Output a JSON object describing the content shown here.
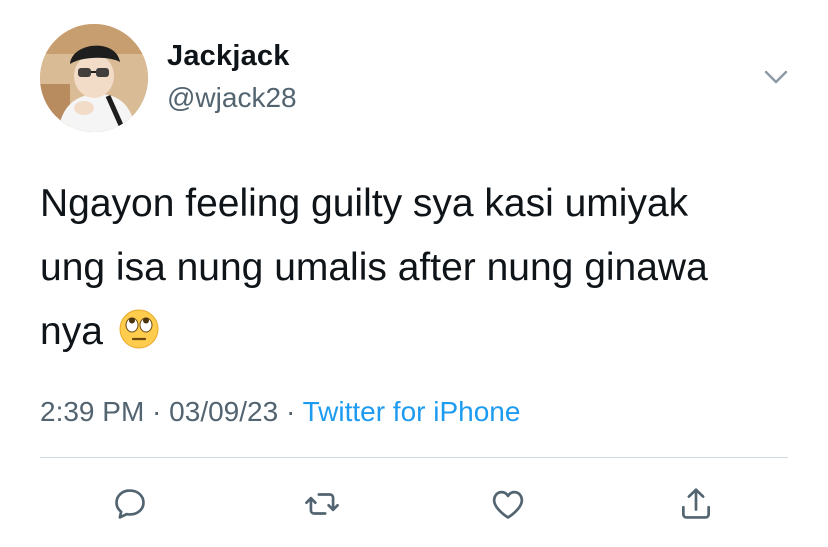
{
  "user": {
    "display_name": "Jackjack",
    "handle": "@wjack28",
    "avatar_icon": "profile-photo"
  },
  "tweet": {
    "text": "Ngayon feeling guilty sya kasi umiyak\nung isa nung umalis after nung ginawa\nnya",
    "emoji": "face-with-rolling-eyes",
    "time": "2:39 PM",
    "separator": " · ",
    "date": "03/09/23",
    "source": "Twitter for iPhone"
  },
  "actions": {
    "reply_icon": "reply-icon",
    "retweet_icon": "retweet-icon",
    "like_icon": "like-icon",
    "share_icon": "share-icon"
  },
  "colors": {
    "text": "#0f1419",
    "secondary": "#536471",
    "accent": "#1d9bf0",
    "divider": "#cfd9de"
  }
}
